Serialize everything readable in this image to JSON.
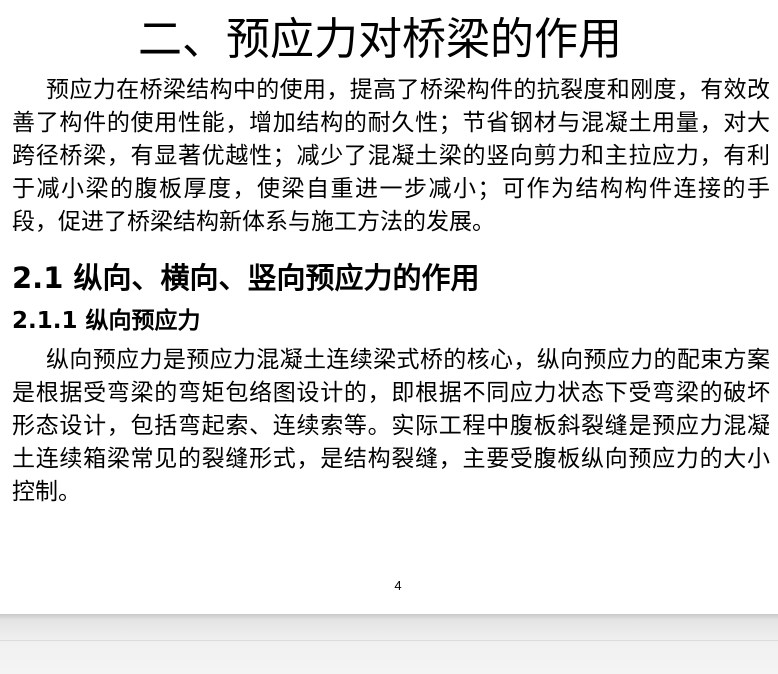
{
  "document": {
    "title": "二、预应力对桥梁的作用",
    "intro_paragraph": "预应力在桥梁结构中的使用，提高了桥梁构件的抗裂度和刚度，有效改善了构件的使用性能，增加结构的耐久性；节省钢材与混凝土用量，对大跨径桥梁，有显著优越性；减少了混凝土梁的竖向剪力和主拉应力，有利于减小梁的腹板厚度，使梁自重进一步减小；可作为结构构件连接的手段，促进了桥梁结构新体系与施工方法的发展。",
    "section": {
      "heading": "2.1  纵向、横向、竖向预应力的作用",
      "subsection": {
        "heading": "2.1.1  纵向预应力",
        "paragraph": "纵向预应力是预应力混凝土连续梁式桥的核心，纵向预应力的配束方案是根据受弯梁的弯矩包络图设计的，即根据不同应力状态下受弯梁的破坏形态设计，包括弯起索、连续索等。实际工程中腹板斜裂缝是预应力混凝土连续箱梁常见的裂缝形式，是结构裂缝，主要受腹板纵向预应力的大小控制。"
      }
    },
    "page_number": "4"
  }
}
